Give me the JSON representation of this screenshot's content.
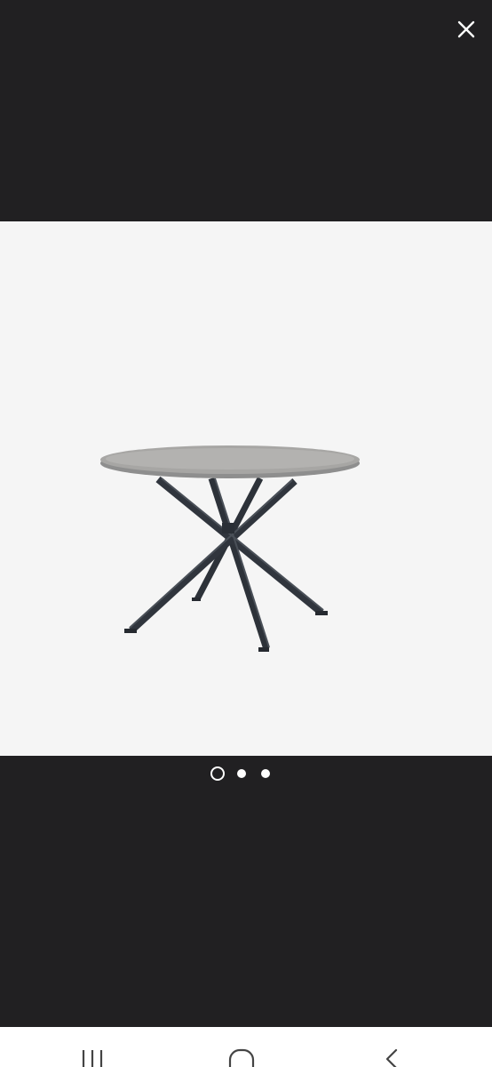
{
  "viewer": {
    "close_icon": "close-icon",
    "background_color": "#212022",
    "photo_background": "#f5f5f5"
  },
  "image_pager": {
    "total": 3,
    "current": 1
  },
  "navbar": {
    "icons": [
      "recent-apps-icon",
      "home-icon",
      "back-icon"
    ]
  }
}
